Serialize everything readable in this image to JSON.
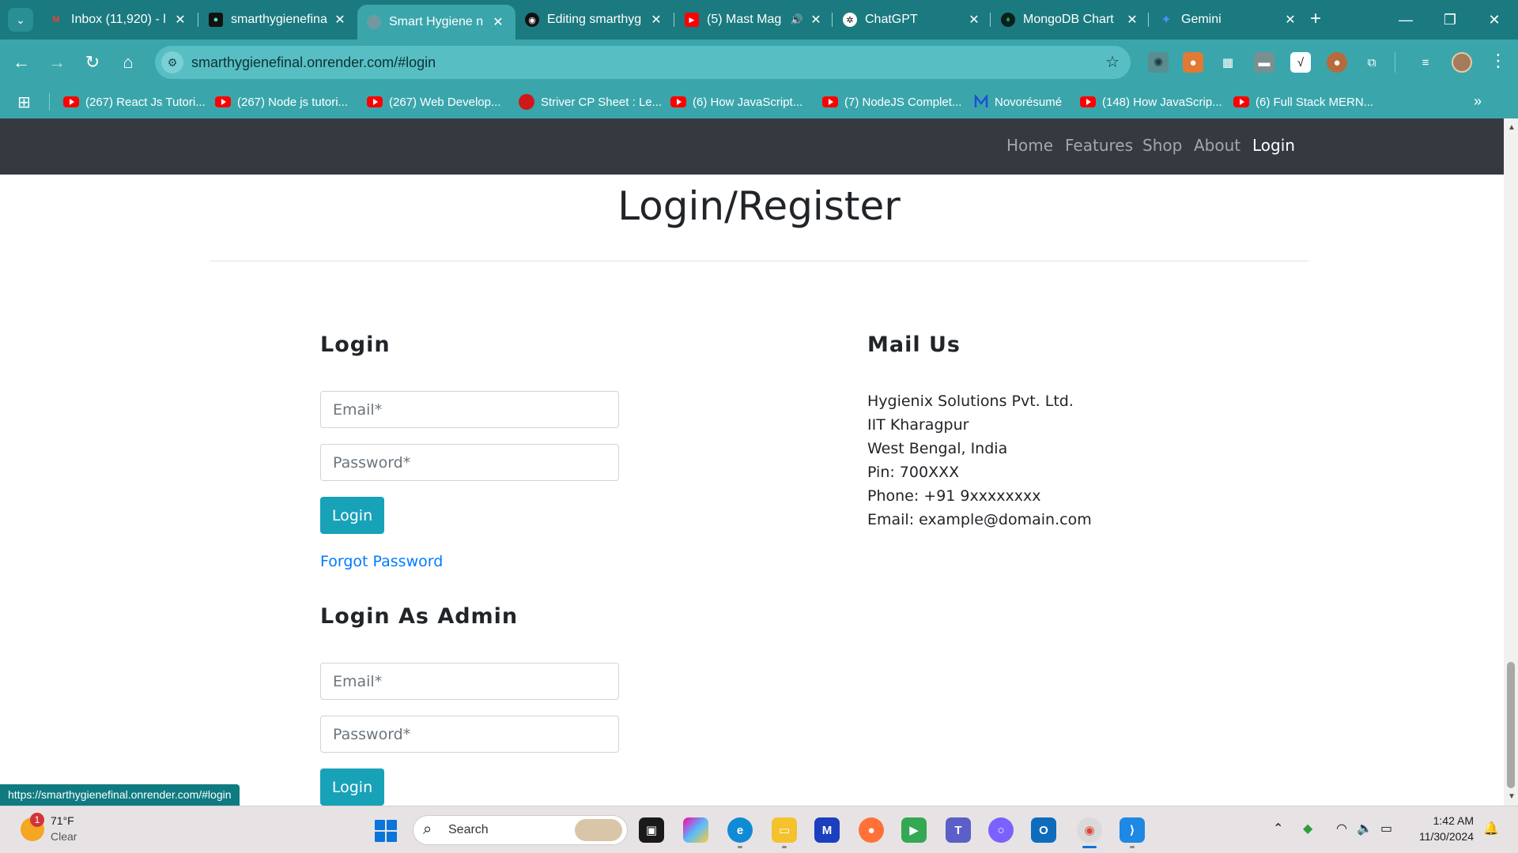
{
  "browser": {
    "tabs": [
      {
        "title": "Inbox (11,920) - l",
        "icon": "gmail-icon",
        "color": "#ea4335"
      },
      {
        "title": "smarthygienefina",
        "icon": "render-icon",
        "color": "#111111"
      },
      {
        "title": "Smart Hygiene n",
        "icon": "globe-icon",
        "color": "#6f9aa0",
        "active": true
      },
      {
        "title": "Editing smarthyg",
        "icon": "github-icon",
        "color": "#111111"
      },
      {
        "title": "(5) Mast Mag",
        "icon": "youtube-icon",
        "color": "#ff0000",
        "audio": true
      },
      {
        "title": "ChatGPT",
        "icon": "chatgpt-icon",
        "color": "#ffffff"
      },
      {
        "title": "MongoDB Chart",
        "icon": "mongodb-icon",
        "color": "#13aa52"
      },
      {
        "title": "Gemini",
        "icon": "gemini-icon",
        "color": "#4f8ef7"
      }
    ],
    "url": "smarthygienefinal.onrender.com/#login",
    "bookmarks": [
      {
        "label": "(267) React Js Tutori...",
        "icon": "youtube-icon"
      },
      {
        "label": "(267) Node js tutori...",
        "icon": "youtube-icon"
      },
      {
        "label": "(267) Web Develop...",
        "icon": "youtube-icon"
      },
      {
        "label": "Striver CP Sheet : Le...",
        "icon": "takeuforward-icon"
      },
      {
        "label": "(6) How JavaScript...",
        "icon": "youtube-icon"
      },
      {
        "label": "(7) NodeJS Complet...",
        "icon": "youtube-icon"
      },
      {
        "label": "Novorésumé",
        "icon": "novoresume-icon"
      },
      {
        "label": "(148) How JavaScrip...",
        "icon": "youtube-icon"
      },
      {
        "label": "(6) Full Stack MERN...",
        "icon": "youtube-icon"
      }
    ],
    "status_url": "https://smarthygienefinal.onrender.com/#login"
  },
  "site": {
    "nav": {
      "home": "Home",
      "features": "Features",
      "shop": "Shop",
      "about": "About",
      "login": "Login"
    },
    "page_title": "Login/Register",
    "login": {
      "heading": "Login",
      "email_placeholder": "Email*",
      "password_placeholder": "Password*",
      "button": "Login",
      "forgot": "Forgot Password"
    },
    "admin": {
      "heading": "Login As Admin",
      "email_placeholder": "Email*",
      "password_placeholder": "Password*",
      "button": "Login"
    },
    "mail": {
      "heading": "Mail Us",
      "company": "Hygienix Solutions Pvt. Ltd.",
      "institute": "IIT Kharagpur",
      "state": "West Bengal, India",
      "pin": "Pin: 700XXX",
      "phone": "Phone: +91 9xxxxxxxx",
      "email": "Email: example@domain.com"
    }
  },
  "taskbar": {
    "weather_temp": "71°F",
    "weather_desc": "Clear",
    "weather_badge": "1",
    "search": "Search",
    "time": "1:42 AM",
    "date": "11/30/2024"
  },
  "colors": {
    "chrome_frame": "#1a7a7f",
    "chrome_toolbar": "#3aa6ac",
    "site_nav": "#343a40",
    "button_info": "#17a2b8",
    "link": "#007bff"
  }
}
